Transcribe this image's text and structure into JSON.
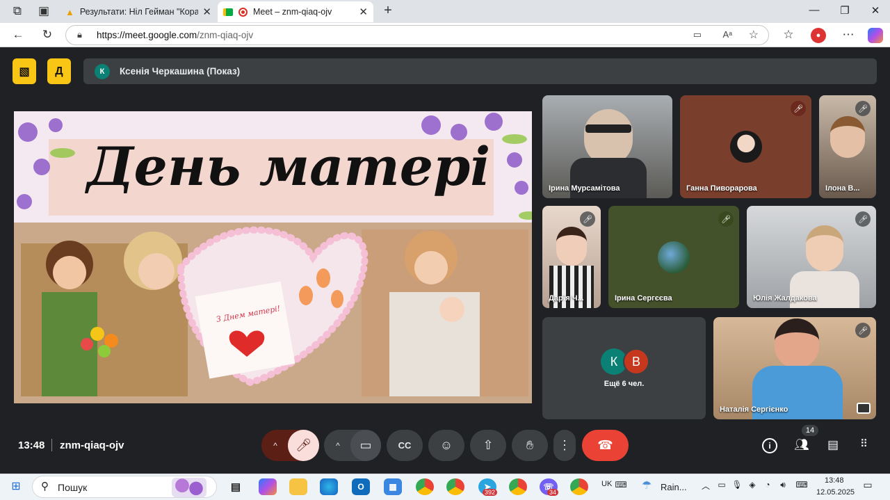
{
  "browser": {
    "tabs": [
      {
        "title": "Результати: Ніл Гейман \"Коралін\"",
        "icon": "warning-icon"
      },
      {
        "title": "Meet – znm-qiaq-ojv",
        "icon": "meet-icon"
      }
    ],
    "url_host": "https://meet.google.com",
    "url_path": "/znm-qiaq-ojv"
  },
  "meet": {
    "presenter": {
      "initial": "К",
      "label": "Ксенія Черкашина (Показ)"
    },
    "slide": {
      "title": "День матері",
      "card_text": "З Днем матері!"
    },
    "participants": [
      {
        "name": "Ірина Мурсамітова",
        "muted": false
      },
      {
        "name": "Ганна Пиворарова",
        "muted": true
      },
      {
        "name": "Ілона В...",
        "muted": true
      },
      {
        "name": "Дар`я Ч...",
        "muted": true
      },
      {
        "name": "Ірина Сергєєва",
        "muted": true
      },
      {
        "name": "Юлія Жалдакова",
        "muted": true
      },
      {
        "name": "Наталія Сергієнко",
        "muted": true
      }
    ],
    "others": {
      "initials": [
        "К",
        "В"
      ],
      "label": "Ещё 6 чел."
    },
    "time": "13:48",
    "meeting_code": "znm-qiaq-ojv",
    "people_count": "14"
  },
  "taskbar": {
    "search": "Пошук",
    "lang": "UK",
    "weather": "Rain...",
    "clock_time": "13:48",
    "clock_date": "12.05.2025",
    "badges": {
      "telegram": "392",
      "viber": "34"
    }
  },
  "colors": {
    "accent_yellow": "#f9c616",
    "end_call": "#ea4335",
    "mic_off": "#f9dedc"
  }
}
